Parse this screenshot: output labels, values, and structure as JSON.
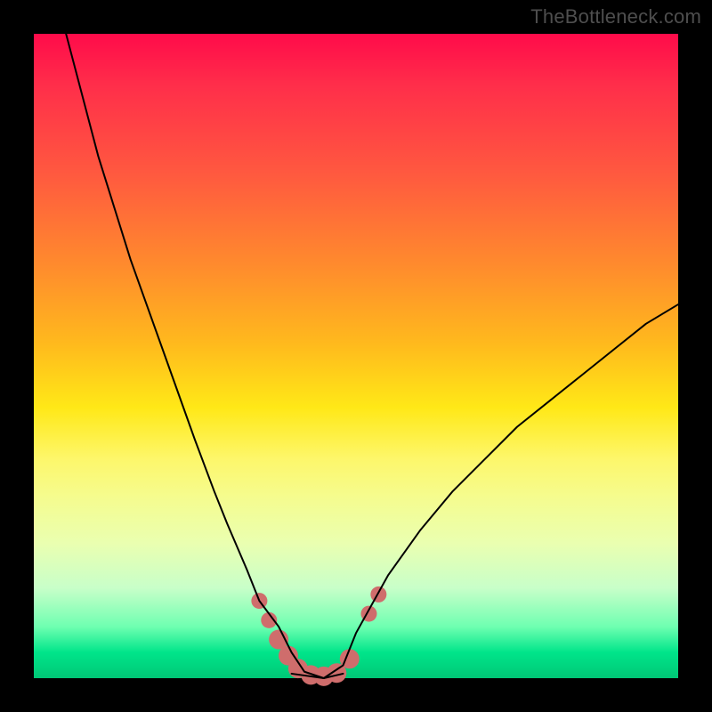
{
  "watermark": "TheBottleneck.com",
  "chart_data": {
    "type": "line",
    "title": "",
    "xlabel": "",
    "ylabel": "",
    "xlim": [
      0,
      100
    ],
    "ylim": [
      0,
      100
    ],
    "grid": false,
    "legend": false,
    "series": [
      {
        "name": "curve",
        "color": "#000000",
        "x": [
          5,
          10,
          15,
          20,
          25,
          28,
          30,
          33,
          35,
          38,
          40,
          42,
          45,
          48,
          50,
          55,
          60,
          65,
          70,
          75,
          80,
          85,
          90,
          95,
          100
        ],
        "values": [
          100,
          81,
          65,
          51,
          37,
          29,
          24,
          17,
          12,
          8,
          4,
          1,
          0,
          2,
          7,
          16,
          23,
          29,
          34,
          39,
          43,
          47,
          51,
          55,
          58
        ]
      },
      {
        "name": "plateau",
        "color": "#000000",
        "x": [
          40,
          45,
          48
        ],
        "values": [
          0.7,
          0,
          0.7
        ]
      }
    ],
    "markers": [
      {
        "x": 35.0,
        "y": 12.0,
        "r": 9,
        "color": "#cf6d6c"
      },
      {
        "x": 36.5,
        "y": 9.0,
        "r": 9,
        "color": "#cf6d6c"
      },
      {
        "x": 38.0,
        "y": 6.0,
        "r": 11,
        "color": "#cf6d6c"
      },
      {
        "x": 39.5,
        "y": 3.5,
        "r": 11,
        "color": "#cf6d6c"
      },
      {
        "x": 41.0,
        "y": 1.5,
        "r": 11,
        "color": "#cf6d6c"
      },
      {
        "x": 43.0,
        "y": 0.5,
        "r": 11,
        "color": "#cf6d6c"
      },
      {
        "x": 45.0,
        "y": 0.3,
        "r": 11,
        "color": "#cf6d6c"
      },
      {
        "x": 47.0,
        "y": 0.8,
        "r": 11,
        "color": "#cf6d6c"
      },
      {
        "x": 49.0,
        "y": 3.0,
        "r": 11,
        "color": "#cf6d6c"
      },
      {
        "x": 52.0,
        "y": 10.0,
        "r": 9,
        "color": "#cf6d6c"
      },
      {
        "x": 53.5,
        "y": 13.0,
        "r": 9,
        "color": "#cf6d6c"
      }
    ]
  }
}
